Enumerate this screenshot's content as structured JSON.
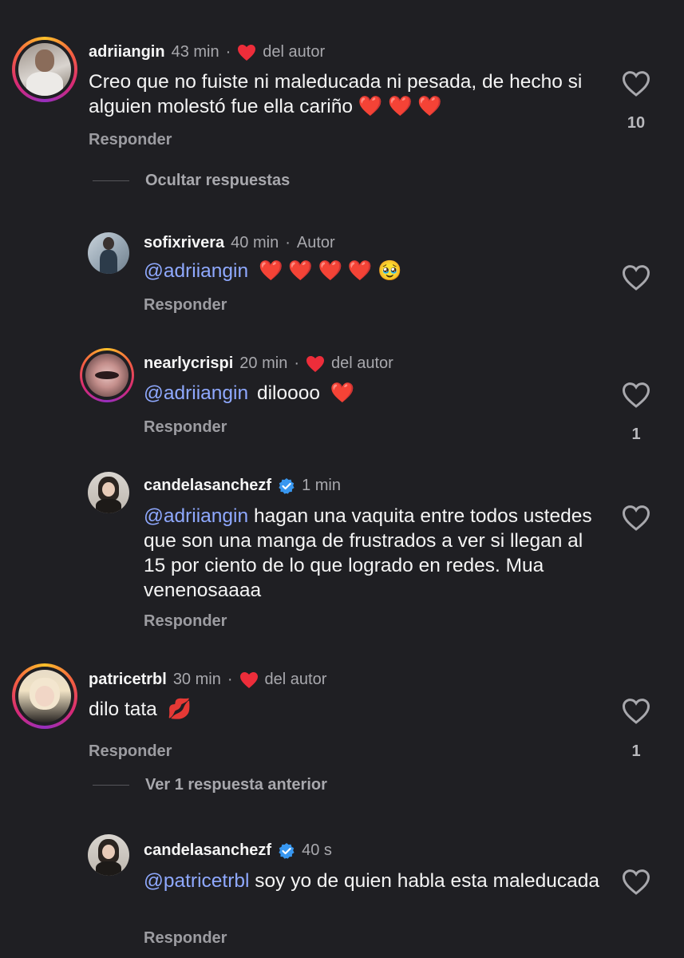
{
  "comments": [
    {
      "username": "adriiangin",
      "time": "43 min",
      "author_like_label": "del autor",
      "text": "Creo que no fuiste ni maleducada ni pesada, de hecho si alguien molestó fue ella cariño ❤️ ❤️ ❤️",
      "reply_label": "Responder",
      "like_count": "10"
    },
    {
      "username": "patricetrbl",
      "time": "30 min",
      "author_like_label": "del autor",
      "text_prefix": "dilo tata",
      "reply_label": "Responder",
      "like_count": "1"
    }
  ],
  "toggles": {
    "hide_replies": "Ocultar respuestas",
    "see_previous": "Ver 1 respuesta anterior"
  },
  "replies": [
    {
      "username": "sofixrivera",
      "time": "40 min",
      "author_tag": "Autor",
      "mention": "@adriiangin",
      "reply_label": "Responder"
    },
    {
      "username": "nearlycrispi",
      "time": "20 min",
      "author_like_label": "del autor",
      "mention": "@adriiangin",
      "text": "diloooo",
      "reply_label": "Responder",
      "like_count": "1"
    },
    {
      "username": "candelasanchezf",
      "time": "1 min",
      "mention": "@adriiangin",
      "text_line1": "hagan una vaquita entre todos",
      "text_rest": "ustedes que son una manga de frustrados a ver si llegan al 15 por ciento de lo que logrado en redes. Mua venenosaaaa",
      "reply_label": "Responder"
    },
    {
      "username": "candelasanchezf",
      "time": "40 s",
      "mention": "@patricetrbl",
      "text_line1": "soy yo de quien habla esta",
      "text_rest": "maleducada",
      "reply_label": "Responder"
    }
  ],
  "colors": {
    "background": "#1f1f23",
    "mention": "#8fa9ff",
    "heart_red": "#ed2d3a",
    "verified_blue": "#3897f0"
  }
}
